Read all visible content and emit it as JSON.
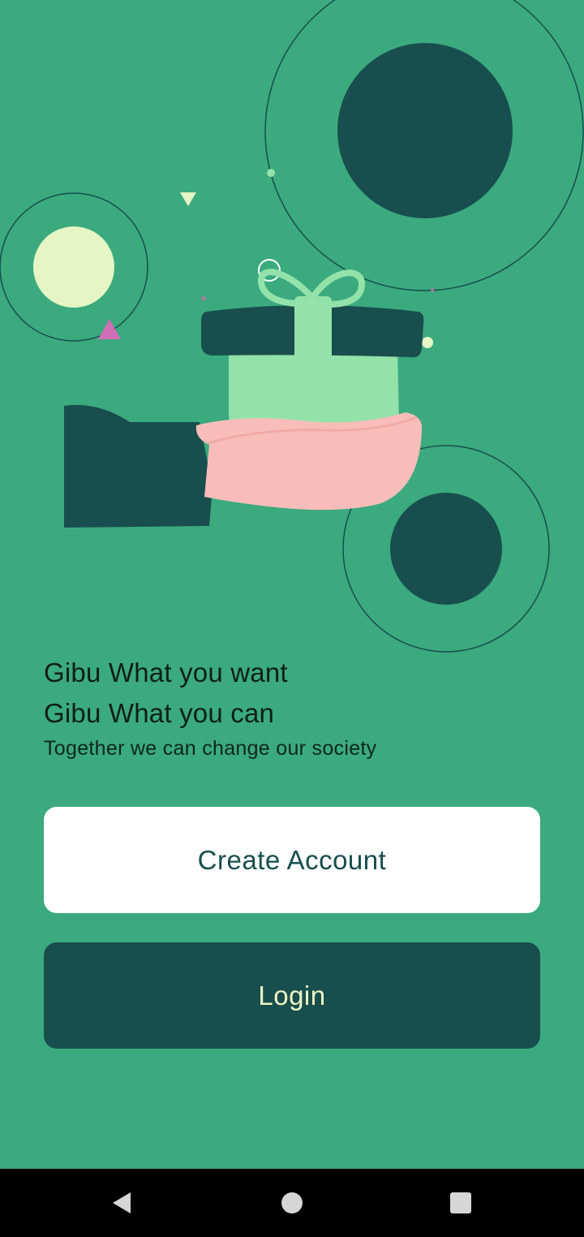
{
  "onboarding": {
    "headline_1": "Gibu What you want",
    "headline_2": "Gibu What you can",
    "tagline": "Together we can change our society"
  },
  "buttons": {
    "create_account": "Create Account",
    "login": "Login"
  },
  "illustration": {
    "subject": "hand-holding-gift-icon"
  },
  "nav_bar": {
    "back": "back-triangle-icon",
    "home": "home-circle-icon",
    "recents": "recents-square-icon"
  },
  "colors": {
    "background": "#3BAA7E",
    "dark_teal": "#184E4E",
    "cream": "#F0F5C4",
    "gift_green": "#93E2A9",
    "hand_pink": "#F8BDBA",
    "accent_pink": "#D06EB6",
    "button_white": "#FFFFFF",
    "nav_bar": "#000000"
  }
}
